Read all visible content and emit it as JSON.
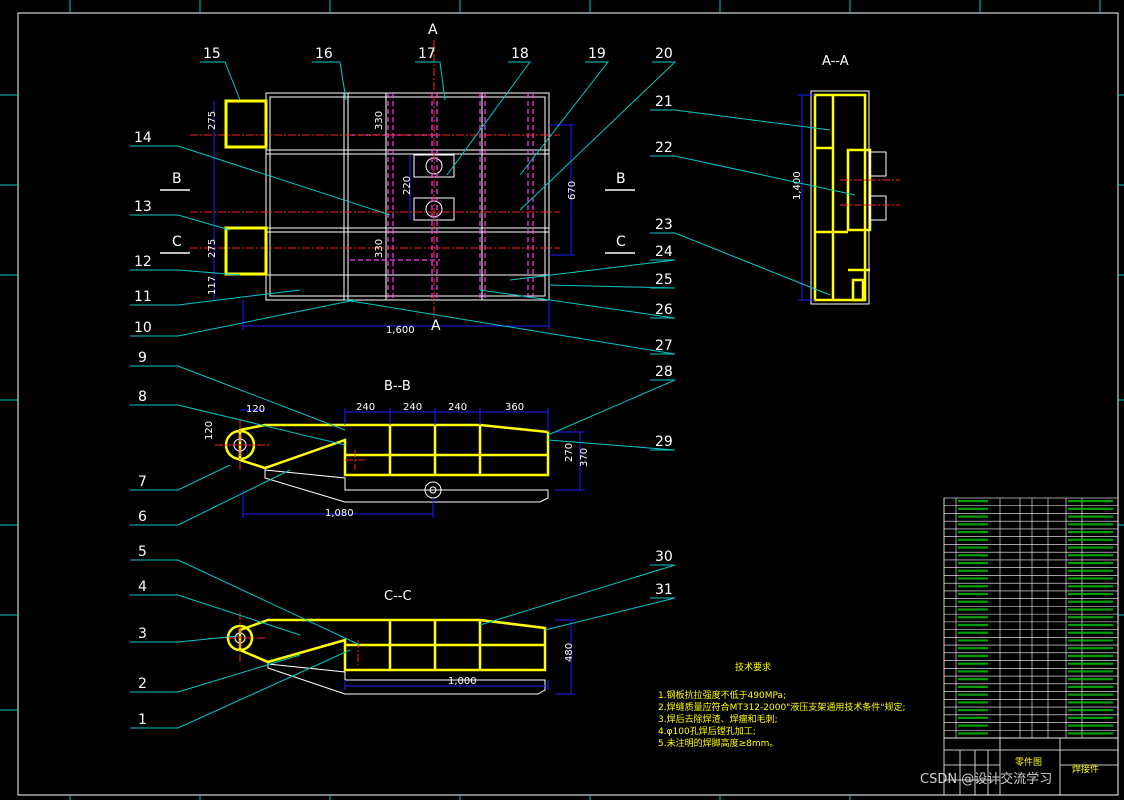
{
  "sheet": {
    "background": "#000000",
    "colors": {
      "frame": "#ffffff",
      "callout": "#00c8c8",
      "dimension": "#1e1eff",
      "section": "#ff3cff",
      "weld": "#ffff00",
      "center": "#ff2020",
      "text": "#ffffff"
    }
  },
  "views": {
    "plan": {
      "section_mark_top": "A",
      "section_mark_bottom": "A",
      "left_mark_b": "B",
      "right_mark_b": "B",
      "left_mark_c": "C",
      "right_mark_c": "C",
      "width_dim": "1,600",
      "height_dim": "670",
      "dim_left_1": "275",
      "dim_left_2": "275",
      "dim_left_3": "117",
      "dim_mid": "220",
      "dim_mid2": "330",
      "dim_mid3": "330"
    },
    "section_aa": {
      "title": "A--A",
      "height_dim": "1,400"
    },
    "section_bb": {
      "title": "B--B",
      "dims_top": [
        "240",
        "240",
        "240",
        "360"
      ],
      "width_dim": "1,080",
      "left_dim": "120",
      "left_dim2": "120",
      "right_dim": "270",
      "right_dim2": "370"
    },
    "section_cc": {
      "title": "C--C",
      "width_dim": "1,000",
      "right_dim": "480"
    }
  },
  "callouts": [
    "1",
    "2",
    "3",
    "4",
    "5",
    "6",
    "7",
    "8",
    "9",
    "10",
    "11",
    "12",
    "13",
    "14",
    "15",
    "16",
    "17",
    "18",
    "19",
    "20",
    "21",
    "22",
    "23",
    "24",
    "25",
    "26",
    "27",
    "28",
    "29",
    "30",
    "31"
  ],
  "technical_requirements": {
    "title": "技术要求",
    "items": [
      "1.钢板抗拉强度不低于490MPa;",
      "2.焊缝质量应符合MT312-2000\"液压支架通用技术条件\"规定;",
      "3.焊后去除焊渣、焊瘤和毛刺;",
      "4.φ100孔焊后镗孔加工;",
      "5.未注明的焊脚高度≥8mm。"
    ]
  },
  "title_block": {
    "label_1": "零件图",
    "label_2": "焊接件"
  },
  "watermark": "CSDN @设计交流学习"
}
